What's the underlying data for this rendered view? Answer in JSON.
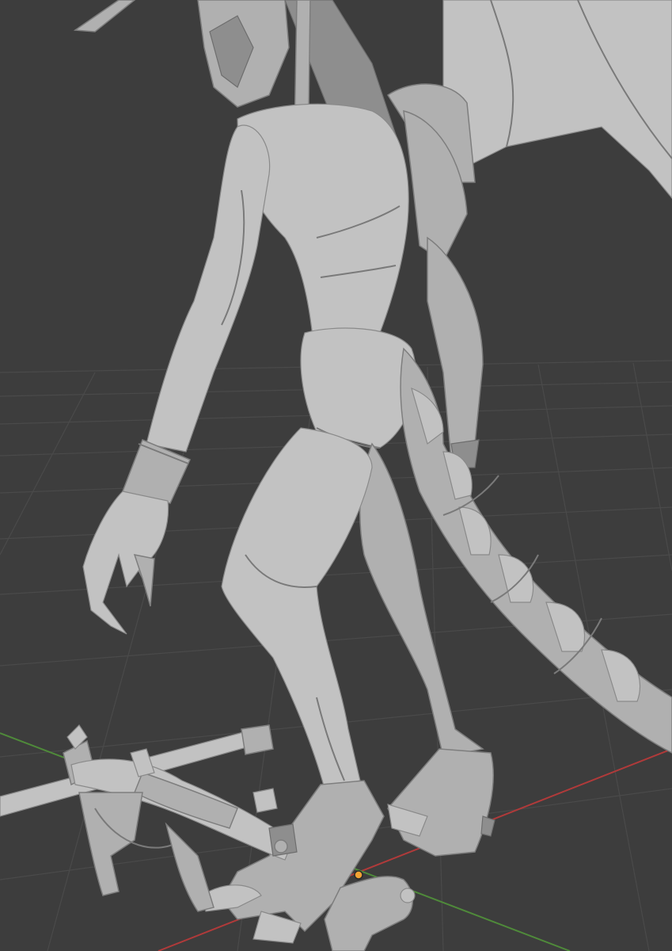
{
  "viewport": {
    "background_color": "#3d3d3d",
    "grid_color": "#4a4a4a",
    "mesh_color": "#b0b0b0",
    "x_axis_color": "#b03a3a",
    "y_axis_color": "#4f8a3a",
    "origin_color": "#f2a233"
  },
  "scene": {
    "objects": [
      "creature-mesh",
      "crossbow-mesh"
    ]
  }
}
